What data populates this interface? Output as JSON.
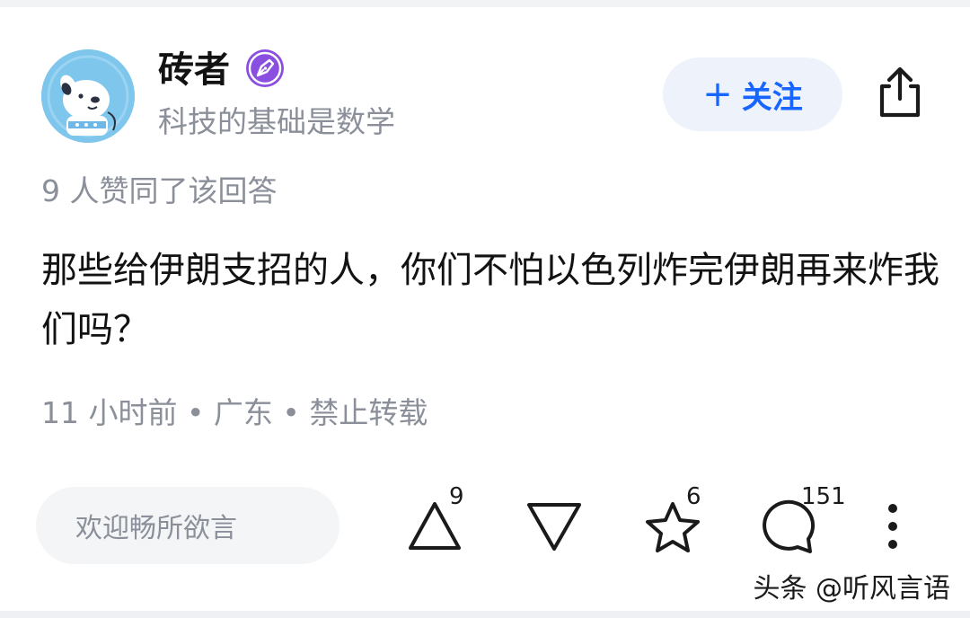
{
  "author": {
    "name": "砖者",
    "bio": "科技的基础是数学",
    "badge_icon": "pen-nib-verified-icon",
    "badge_color": "#8a4fe0",
    "avatar_icon": "cartoon-dog-avatar"
  },
  "header": {
    "follow_label": "关注",
    "follow_plus": "+",
    "follow_color": "#1766ff",
    "share_icon": "share-icon"
  },
  "answer": {
    "likes_text": "9 人赞同了该回答",
    "text": "那些给伊朗支招的人，你们不怕以色列炸完伊朗再来炸我们吗？",
    "meta": "11 小时前 • 广东 • 禁止转载"
  },
  "actions": {
    "comment_placeholder": "欢迎畅所欲言",
    "upvote_icon": "upvote-triangle-icon",
    "upvote_count": "9",
    "downvote_icon": "downvote-triangle-icon",
    "favorite_icon": "star-icon",
    "favorite_count": "6",
    "comment_icon": "comment-bubble-icon",
    "comment_count": "151",
    "more_icon": "more-vertical-icon"
  },
  "watermark": "头条 @听风言语"
}
